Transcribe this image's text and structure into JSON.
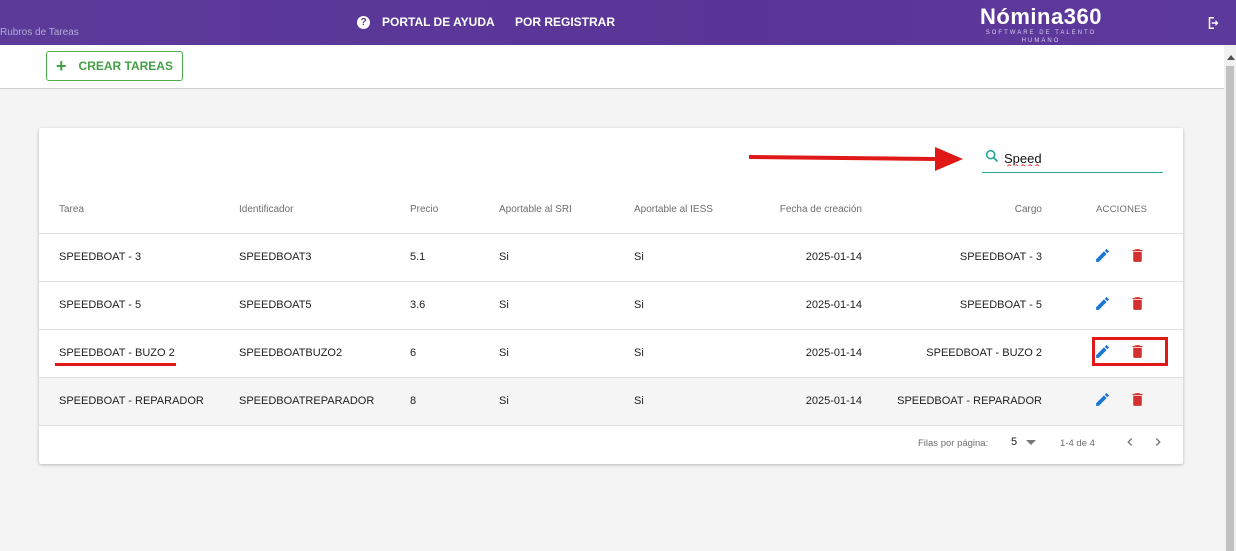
{
  "header": {
    "breadcrumb": "Rubros de Tareas",
    "nav_help": "PORTAL DE AYUDA",
    "nav_register": "POR REGISTRAR",
    "logo_main": "Nómina360",
    "logo_sub": "SOFTWARE DE TALENTO HUMANO",
    "help_icon_glyph": "?",
    "brand_color": "#5a3597"
  },
  "toolbar": {
    "create_label": "CREAR TAREAS",
    "create_icon": "+"
  },
  "search": {
    "value": "Speed"
  },
  "table": {
    "headers": [
      "Tarea",
      "Identificador",
      "Precio",
      "Aportable al SRI",
      "Aportable al IESS",
      "Fecha de creación",
      "Cargo",
      "ACCIONES"
    ],
    "rows": [
      {
        "tarea": "SPEEDBOAT - 3",
        "id": "SPEEDBOAT3",
        "precio": "5.1",
        "sri": "Si",
        "iess": "Si",
        "fecha": "2025-01-14",
        "cargo": "SPEEDBOAT - 3"
      },
      {
        "tarea": "SPEEDBOAT - 5",
        "id": "SPEEDBOAT5",
        "precio": "3.6",
        "sri": "Si",
        "iess": "Si",
        "fecha": "2025-01-14",
        "cargo": "SPEEDBOAT - 5"
      },
      {
        "tarea": "SPEEDBOAT - BUZO 2",
        "id": "SPEEDBOATBUZO2",
        "precio": "6",
        "sri": "Si",
        "iess": "Si",
        "fecha": "2025-01-14",
        "cargo": "SPEEDBOAT - BUZO 2"
      },
      {
        "tarea": "SPEEDBOAT - REPARADOR",
        "id": "SPEEDBOATREPARADOR",
        "precio": "8",
        "sri": "Si",
        "iess": "Si",
        "fecha": "2025-01-14",
        "cargo": "SPEEDBOAT - REPARADOR"
      }
    ],
    "edit_color": "#1976d2",
    "delete_color": "#d32f2f"
  },
  "pagination": {
    "rows_label": "Filas por página:",
    "rows_value": "5",
    "range": "1-4 de 4"
  },
  "icons": {
    "help": "help-circle-icon",
    "logout": "logout-icon",
    "search": "search-icon",
    "edit": "pencil-icon",
    "delete": "trash-icon",
    "prev": "chevron-left-icon",
    "next": "chevron-right-icon"
  },
  "annotation_color": "#e01818"
}
